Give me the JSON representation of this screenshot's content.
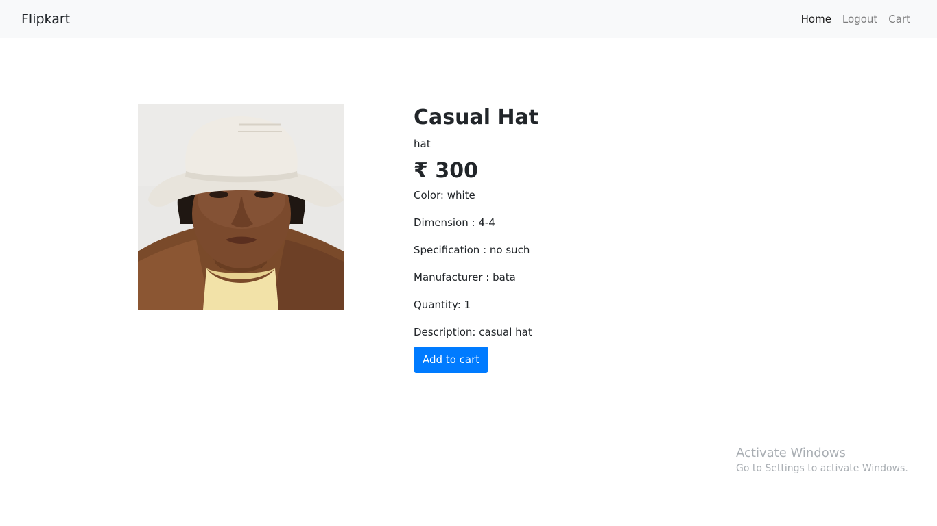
{
  "navbar": {
    "brand": "Flipkart",
    "links": [
      {
        "label": "Home",
        "active": true
      },
      {
        "label": "Logout",
        "active": false
      },
      {
        "label": "Cart",
        "active": false
      }
    ]
  },
  "product": {
    "title": "Casual Hat",
    "subtitle": "hat",
    "price": "₹ 300",
    "specs": {
      "color": "Color: white",
      "dimension": "Dimension : 4-4",
      "specification": "Specification : no such",
      "manufacturer": "Manufacturer : bata",
      "quantity": "Quantity: 1",
      "description": "Description: casual hat"
    },
    "add_to_cart_label": "Add to cart",
    "image_alt": "man wearing white bucket hat and brown corduroy jacket"
  },
  "watermark": {
    "title": "Activate Windows",
    "subtitle": "Go to Settings to activate Windows."
  },
  "colors": {
    "navbar_bg": "#f8f9fa",
    "primary": "#007bff",
    "text": "#212529"
  }
}
